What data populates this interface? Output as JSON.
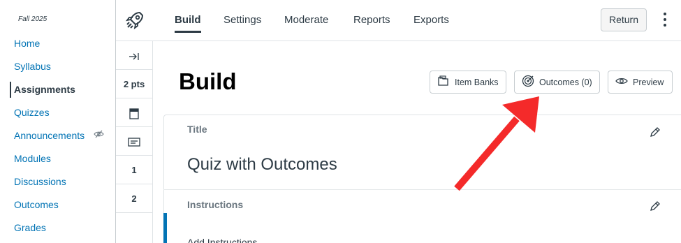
{
  "course": {
    "term": "Fall 2025"
  },
  "nav": {
    "items": [
      {
        "label": "Home"
      },
      {
        "label": "Syllabus"
      },
      {
        "label": "Assignments"
      },
      {
        "label": "Quizzes"
      },
      {
        "label": "Announcements"
      },
      {
        "label": "Modules"
      },
      {
        "label": "Discussions"
      },
      {
        "label": "Outcomes"
      },
      {
        "label": "Grades"
      }
    ],
    "active": "Assignments",
    "hidden_item_icon": "eye-slash-icon"
  },
  "topbar": {
    "logo_icon": "rocket-icon",
    "tabs": [
      {
        "label": "Build"
      },
      {
        "label": "Settings"
      },
      {
        "label": "Moderate"
      },
      {
        "label": "Reports"
      },
      {
        "label": "Exports"
      }
    ],
    "active_tab": "Build",
    "return_label": "Return",
    "more_icon": "kebab-icon"
  },
  "items": {
    "expand_icon": "collapse-arrow-icon",
    "points": "2 pts",
    "cells": [
      "1",
      "2"
    ]
  },
  "main": {
    "title": "Build",
    "buttons": {
      "item_banks": "Item Banks",
      "outcomes": "Outcomes (0)",
      "preview": "Preview"
    },
    "title_label": "Title",
    "quiz_title": "Quiz with Outcomes",
    "instructions_label": "Instructions",
    "add_instructions": "Add Instructions"
  },
  "colors": {
    "link": "#0374b5",
    "text": "#2d3b45",
    "annotation_arrow": "#f42a2a"
  }
}
